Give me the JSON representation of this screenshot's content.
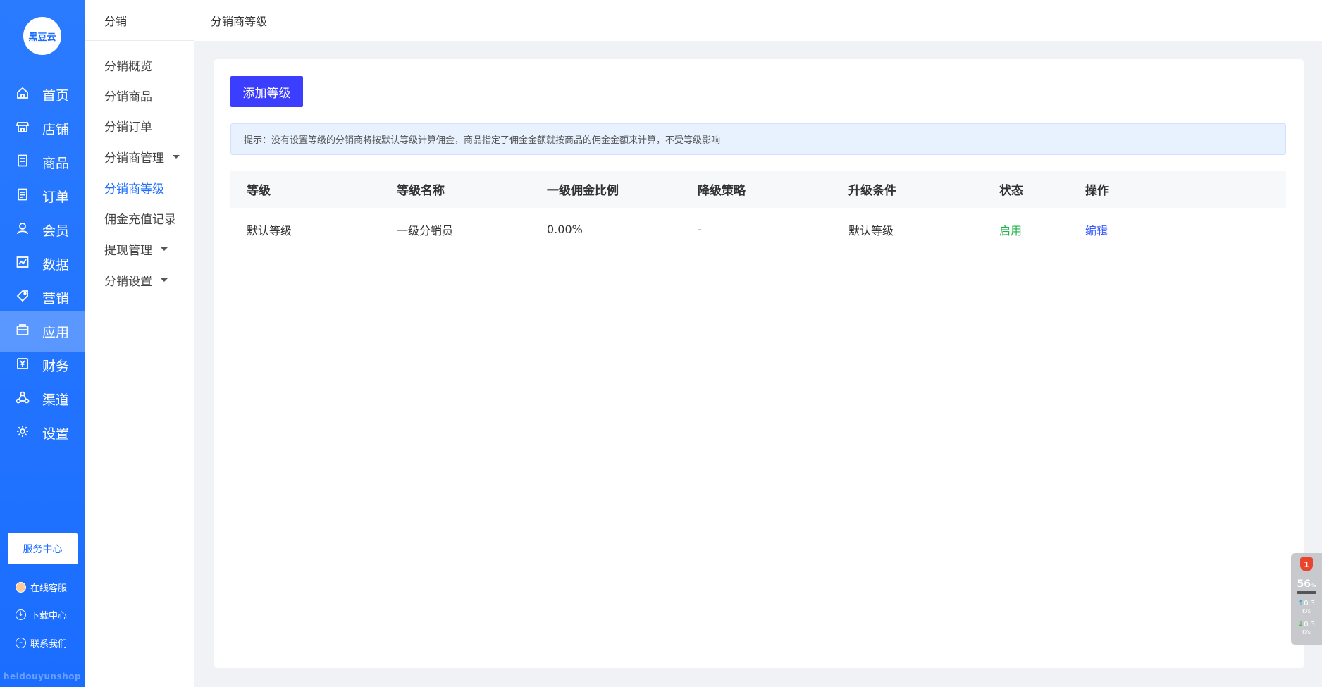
{
  "brand": {
    "logo_text": "黑豆云",
    "watermark": "heidouyunshop"
  },
  "primary_nav": [
    {
      "label": "首页",
      "icon": "home-icon"
    },
    {
      "label": "店铺",
      "icon": "store-icon"
    },
    {
      "label": "商品",
      "icon": "product-icon"
    },
    {
      "label": "订单",
      "icon": "order-icon"
    },
    {
      "label": "会员",
      "icon": "member-icon"
    },
    {
      "label": "数据",
      "icon": "chart-icon"
    },
    {
      "label": "营销",
      "icon": "tag-icon"
    },
    {
      "label": "应用",
      "icon": "app-icon",
      "active": true
    },
    {
      "label": "财务",
      "icon": "finance-icon"
    },
    {
      "label": "渠道",
      "icon": "channel-icon"
    },
    {
      "label": "设置",
      "icon": "gear-icon"
    }
  ],
  "service": {
    "center_label": "服务中心",
    "links": [
      {
        "label": "在线客服",
        "icon": "avatar-icon"
      },
      {
        "label": "下载中心",
        "icon": "download-icon"
      },
      {
        "label": "联系我们",
        "icon": "contact-icon"
      }
    ]
  },
  "secondary_nav": {
    "title": "分销",
    "items": [
      {
        "label": "分销概览"
      },
      {
        "label": "分销商品"
      },
      {
        "label": "分销订单"
      },
      {
        "label": "分销商管理",
        "has_caret": true
      },
      {
        "label": "分销商等级",
        "active": true
      },
      {
        "label": "佣金充值记录"
      },
      {
        "label": "提现管理",
        "has_caret": true
      },
      {
        "label": "分销设置",
        "has_caret": true
      }
    ]
  },
  "page": {
    "title": "分销商等级",
    "add_button": "添加等级",
    "tip": "提示：没有设置等级的分销商将按默认等级计算佣金，商品指定了佣金金额就按商品的佣金金额来计算，不受等级影响"
  },
  "table": {
    "headers": [
      "等级",
      "等级名称",
      "一级佣金比例",
      "降级策略",
      "升级条件",
      "状态",
      "操作"
    ],
    "rows": [
      {
        "level": "默认等级",
        "name": "一级分销员",
        "rate": "0.00%",
        "downgrade": "-",
        "upgrade": "默认等级",
        "status": "启用",
        "action": "编辑"
      }
    ]
  },
  "widget": {
    "badge": "1",
    "percent": "56",
    "percent_unit": "%",
    "up": "0.3",
    "down": "0.3",
    "rate_unit": "K/s"
  },
  "colors": {
    "primary": "#1a6dff",
    "button": "#3b3dff",
    "status_on": "#22b24c",
    "link": "#3b5bff"
  }
}
